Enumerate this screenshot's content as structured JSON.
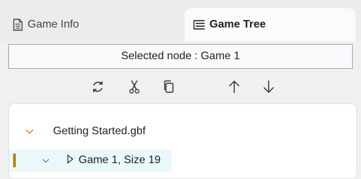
{
  "tabs": [
    {
      "label": "Game Info",
      "icon": "document-icon",
      "active": false
    },
    {
      "label": "Game Tree",
      "icon": "tree-list-icon",
      "active": true
    }
  ],
  "selected_node": {
    "text": "Selected node : Game 1"
  },
  "toolbar": {
    "icons": [
      "refresh-icon",
      "cut-icon",
      "copy-icon",
      "arrow-up-icon",
      "arrow-down-icon"
    ]
  },
  "tree": {
    "root": {
      "label": "Getting Started.gbf",
      "expanded": true,
      "chevron_color": "#e07a3a"
    },
    "child": {
      "label": "Game 1, Size 19",
      "expanded": true,
      "selected": true,
      "selection_color": "#b8860b"
    }
  },
  "colors": {
    "accent": "#b8860b",
    "selection_bg": "#eaf7fb"
  }
}
